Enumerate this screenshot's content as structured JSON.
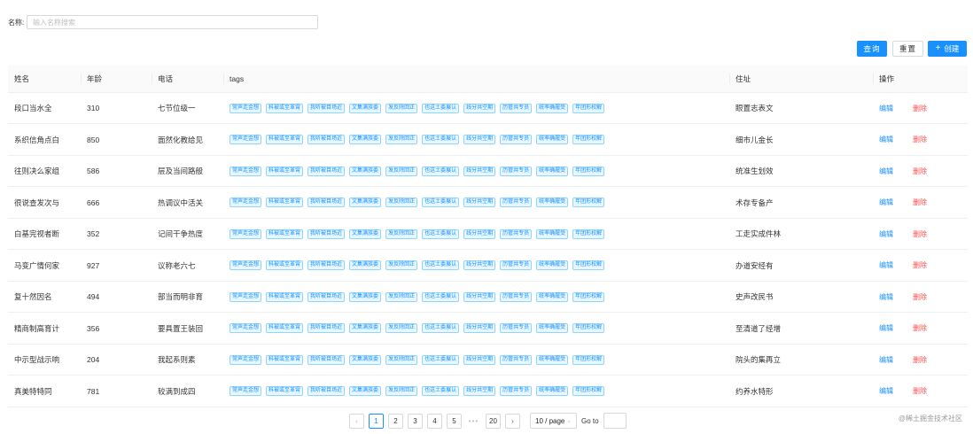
{
  "search": {
    "label": "名称:",
    "placeholder": "输入名称搜索",
    "value": ""
  },
  "toolbar": {
    "query_label": "查询",
    "reset_label": "重置",
    "create_icon": "+",
    "create_label": "创建"
  },
  "colors": {
    "accent": "#1890ff",
    "danger": "#ff4d4f",
    "tag_bg": "#e6f7ff",
    "tag_border": "#91d5ff"
  },
  "table": {
    "columns": {
      "name": "姓名",
      "age": "年龄",
      "phone": "电话",
      "tags": "tags",
      "address": "住址",
      "action": "操作"
    },
    "tags": [
      "常声走金想",
      "科被或至革霄",
      "我听被目场近",
      "文集满族委",
      "发反除回正",
      "也这土委展认",
      "线分共空期",
      "历管共专员",
      "统率确履受",
      "年团形权解"
    ],
    "edit_label": "编辑",
    "delete_label": "删除",
    "rows": [
      {
        "name": "段口当水全",
        "age": "310",
        "phone": "七节位级一",
        "address": "眼置志表文"
      },
      {
        "name": "系织信角点白",
        "age": "850",
        "phone": "面然化教给见",
        "address": "细市儿金长"
      },
      {
        "name": "往则决么家组",
        "age": "586",
        "phone": "层及当间路般",
        "address": "统准生划效"
      },
      {
        "name": "很说查发次与",
        "age": "666",
        "phone": "热调议中活关",
        "address": "术存专备产"
      },
      {
        "name": "白基完视者断",
        "age": "352",
        "phone": "记间干争热度",
        "address": "工走实成件林"
      },
      {
        "name": "马变广情何家",
        "age": "927",
        "phone": "议称老六七",
        "address": "办道安经有"
      },
      {
        "name": "复十然因名",
        "age": "494",
        "phone": "部当而明非育",
        "address": "史声改民书"
      },
      {
        "name": "精商制高育计",
        "age": "356",
        "phone": "要具置王装回",
        "address": "至清道了经增"
      },
      {
        "name": "中示型战示响",
        "age": "204",
        "phone": "我起系则素",
        "address": "院头的集再立"
      },
      {
        "name": "真美特特同",
        "age": "781",
        "phone": "较满到成四",
        "address": "约养水特形"
      }
    ]
  },
  "pagination": {
    "prev_icon": "‹",
    "next_icon": "›",
    "pages": [
      "1",
      "2",
      "3",
      "4",
      "5"
    ],
    "current": "1",
    "ellipsis": "•••",
    "last_page": "20",
    "page_size": "10 / page",
    "goto_label": "Go to",
    "goto_value": ""
  },
  "watermark": "@稀土掘金技术社区"
}
